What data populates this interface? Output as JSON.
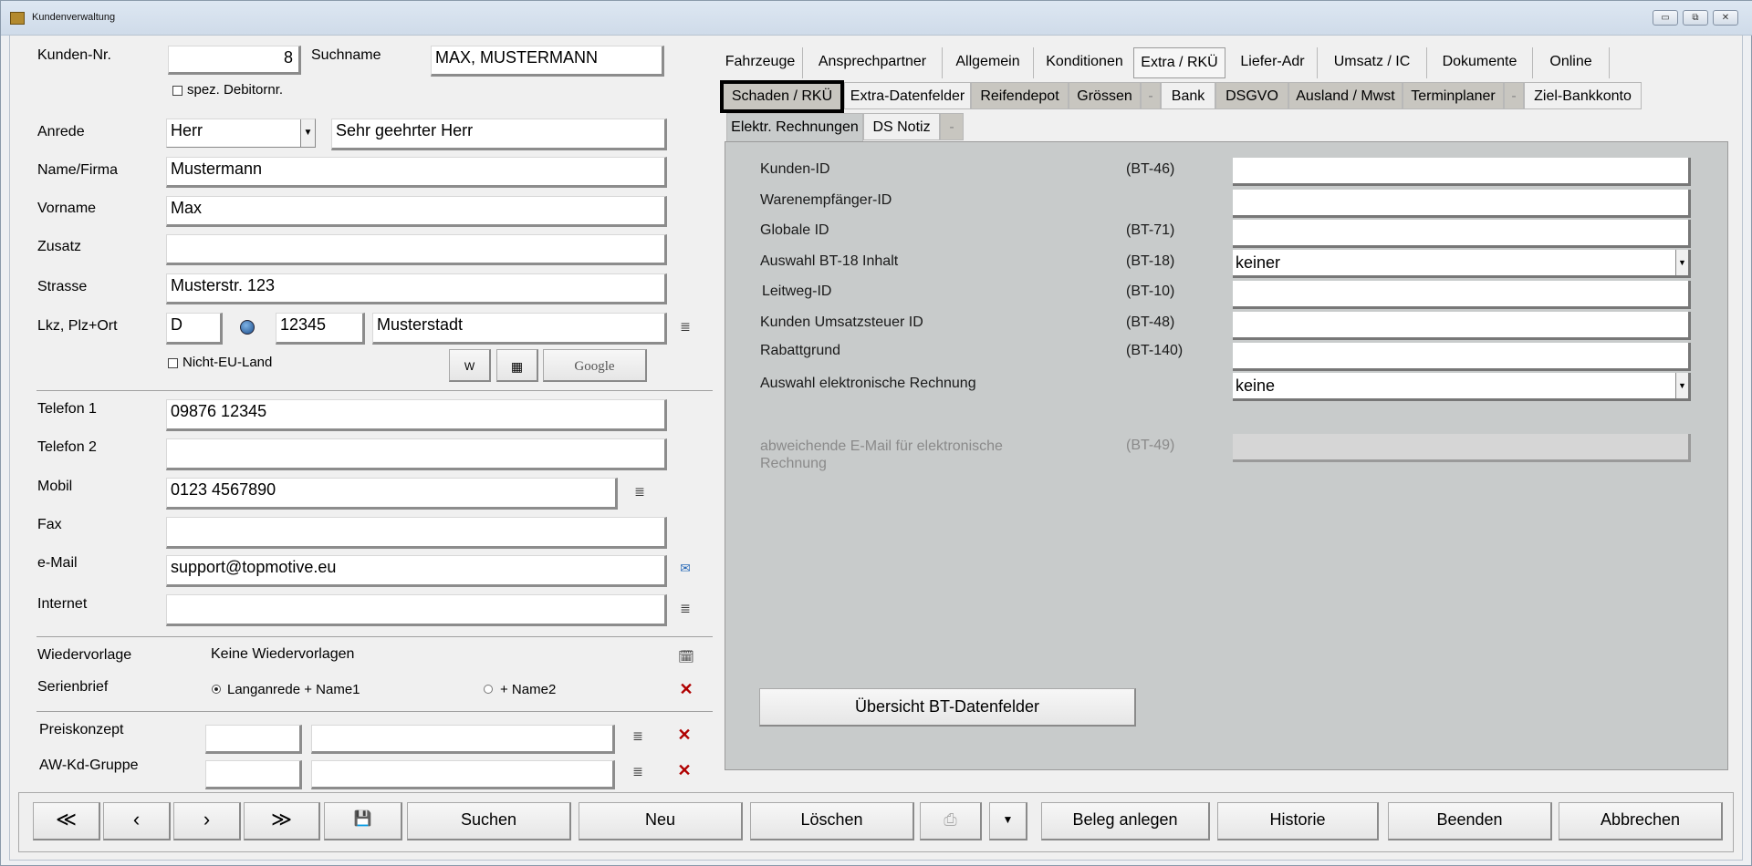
{
  "window": {
    "title": "Kundenverwaltung",
    "btn_min": "▭",
    "btn_max": "⧉",
    "btn_close": "✕"
  },
  "form": {
    "kundennr_label": "Kunden-Nr.",
    "kundennr": "8",
    "suchname_label": "Suchname",
    "suchname": "MAX, MUSTERMANN",
    "spez_debitor_label": "spez. Debitornr.",
    "anrede_label": "Anrede",
    "anrede": "Herr",
    "briefanrede": "Sehr geehrter Herr",
    "name_label": "Name/Firma",
    "name": "Mustermann",
    "vorname_label": "Vorname",
    "vorname": "Max",
    "zusatz_label": "Zusatz",
    "zusatz": "",
    "strasse_label": "Strasse",
    "strasse": "Musterstr. 123",
    "lkz_label": "Lkz, Plz+Ort",
    "lkz": "D",
    "plz": "12345",
    "ort": "Musterstadt",
    "nicht_eu_label": "Nicht-EU-Land",
    "google_label": "Google",
    "telefon1_label": "Telefon 1",
    "telefon1": "09876 12345",
    "telefon2_label": "Telefon 2",
    "telefon2": "",
    "mobil_label": "Mobil",
    "mobil": "0123 4567890",
    "fax_label": "Fax",
    "fax": "",
    "email_label": "e-Mail",
    "email": "support@topmotive.eu",
    "internet_label": "Internet",
    "internet": "",
    "wiedervorlage_label": "Wiedervorlage",
    "wiedervorlage_value": "Keine Wiedervorlagen",
    "serienbrief_label": "Serienbrief",
    "serienbrief_opt1": "Langanrede + Name1",
    "serienbrief_opt2": "+ Name2",
    "preiskonzept_label": "Preiskonzept",
    "awkd_label": "AW-Kd-Gruppe"
  },
  "tabs": [
    "Fahrzeuge",
    "Ansprechpartner",
    "Allgemein",
    "Konditionen",
    "Extra / RKÜ",
    "Liefer-Adr",
    "Umsatz / IC",
    "Dokumente",
    "Online"
  ],
  "subtabs_row1": [
    "Schaden / RKÜ",
    "Extra-Datenfelder",
    "Reifendepot",
    "Grössen",
    "-",
    "Bank",
    "DSGVO",
    "Ausland / Mwst",
    "Terminplaner",
    "-",
    "Ziel-Bankkonto"
  ],
  "subtabs_row2": [
    "Elektr. Rechnungen",
    "DS Notiz",
    "-"
  ],
  "erechnung": {
    "rows": [
      {
        "label": "Kunden-ID",
        "code": "(BT-46)",
        "value": ""
      },
      {
        "label": "Warenempfänger-ID",
        "code": "",
        "value": ""
      },
      {
        "label": "Globale ID",
        "code": "(BT-71)",
        "value": ""
      },
      {
        "label": "Auswahl BT-18 Inhalt",
        "code": "(BT-18)",
        "value": "keiner"
      },
      {
        "label": "Leitweg-ID",
        "code": "(BT-10)",
        "value": ""
      },
      {
        "label": "Kunden Umsatzsteuer ID",
        "code": "(BT-48)",
        "value": ""
      },
      {
        "label": "Rabattgrund",
        "code": "(BT-140)",
        "value": ""
      },
      {
        "label": "Auswahl  elektronische Rechnung",
        "code": "",
        "value": "keine"
      }
    ],
    "email_label_1": "abweichende E-Mail für elektronische",
    "email_label_2": "Rechnung",
    "email_code": "(BT-49)",
    "uebersicht_button": "Übersicht BT-Datenfelder"
  },
  "toolbar": {
    "first": "≪",
    "prev": "‹",
    "next": "›",
    "last": "≫",
    "suchen": "Suchen",
    "neu": "Neu",
    "loeschen": "Löschen",
    "beleg": "Beleg anlegen",
    "historie": "Historie",
    "beenden": "Beenden",
    "abbrechen": "Abbrechen"
  }
}
